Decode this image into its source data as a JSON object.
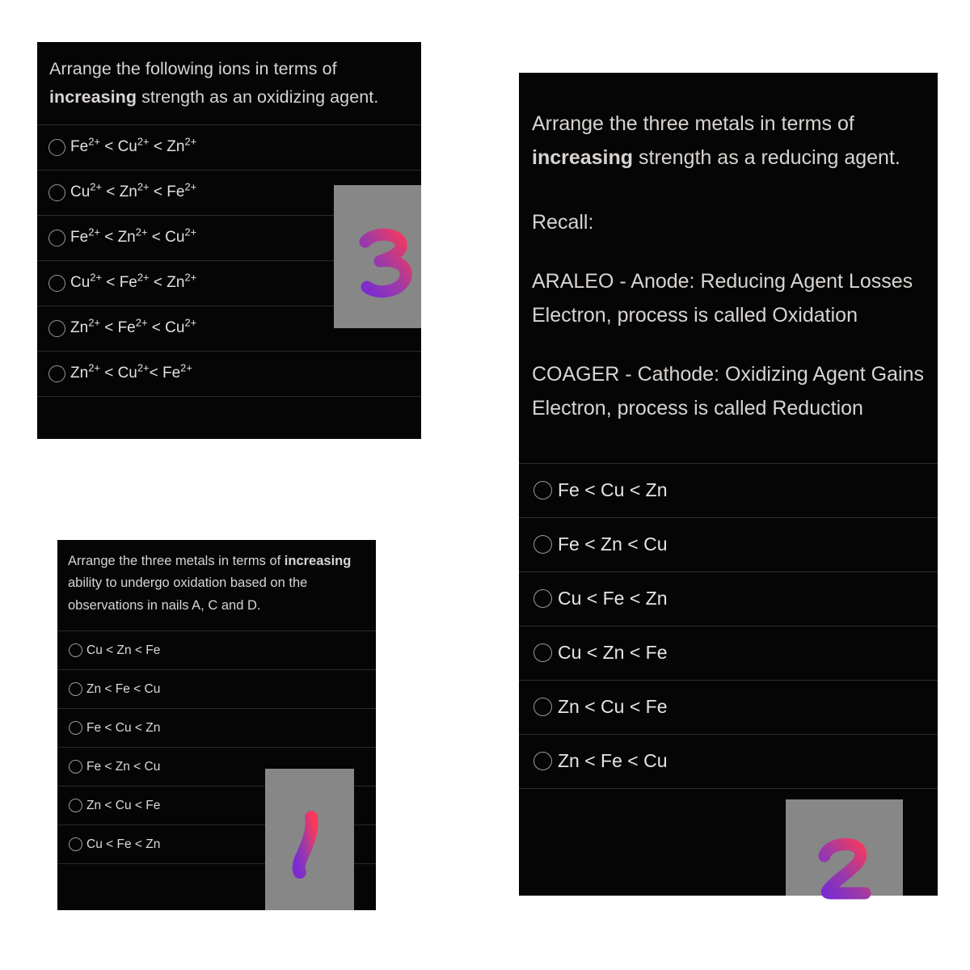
{
  "page": {
    "background_color": "#ffffff",
    "panel_background_color": "#050505",
    "text_color": "#d8d4d1",
    "divider_color": "#2b2b2b",
    "stamp_box_color": "#878787",
    "digit_gradient_start": "#6a2fc0",
    "digit_gradient_end": "#f43b5c"
  },
  "panel_ions": {
    "question_part1": "Arrange the following ions in terms of ",
    "question_bold": "increasing",
    "question_part2": " strength as an oxidizing agent.",
    "options": [
      {
        "ion1": "Fe",
        "c1": "2+",
        "ion2": "Cu",
        "c2": "2+",
        "ion3": "Zn",
        "c3": "2+"
      },
      {
        "ion1": "Cu",
        "c1": "2+",
        "ion2": "Zn",
        "c2": "2+",
        "ion3": "Fe",
        "c3": "2+"
      },
      {
        "ion1": "Fe",
        "c1": "2+",
        "ion2": "Zn",
        "c2": "2+",
        "ion3": "Cu",
        "c3": "2+"
      },
      {
        "ion1": "Cu",
        "c1": "2+",
        "ion2": "Fe",
        "c2": "2+",
        "ion3": "Zn",
        "c3": "2+"
      },
      {
        "ion1": "Zn",
        "c1": "2+",
        "ion2": "Fe",
        "c2": "2+",
        "ion3": "Cu",
        "c3": "2+"
      },
      {
        "ion1": "Zn",
        "c1": "2+",
        "ion2": "Cu",
        "c2": "2+",
        "ion3": "Fe",
        "c3": "2+"
      }
    ],
    "separator": "<"
  },
  "panel_reducing": {
    "question_part1": "Arrange the three metals in terms of ",
    "question_bold": "increasing",
    "question_part2": " strength as a reducing agent.",
    "recall_label": "Recall:",
    "recall_paragraph_1": "ARALEO - Anode: Reducing Agent Losses Electron, process is called Oxidation",
    "recall_paragraph_2": "COAGER - Cathode: Oxidizing Agent Gains Electron, process is called Reduction",
    "options": [
      "Fe < Cu < Zn",
      "Fe < Zn < Cu",
      "Cu < Fe < Zn",
      "Cu < Zn < Fe",
      "Zn < Cu < Fe",
      "Zn < Fe < Cu"
    ]
  },
  "panel_oxidation": {
    "question_part1": "Arrange the three metals in terms of ",
    "question_bold": "increasing",
    "question_part2": " ability to undergo oxidation based on the observations in nails A, C and D.",
    "options": [
      "Cu < Zn < Fe",
      "Zn < Fe < Cu",
      "Fe < Cu < Zn",
      "Fe < Zn < Cu",
      "Zn < Cu < Fe",
      "Cu < Fe < Zn"
    ]
  },
  "stamps": [
    {
      "id": "stamp-3",
      "digit": "3"
    },
    {
      "id": "stamp-1",
      "digit": "1"
    },
    {
      "id": "stamp-2",
      "digit": "2"
    }
  ]
}
